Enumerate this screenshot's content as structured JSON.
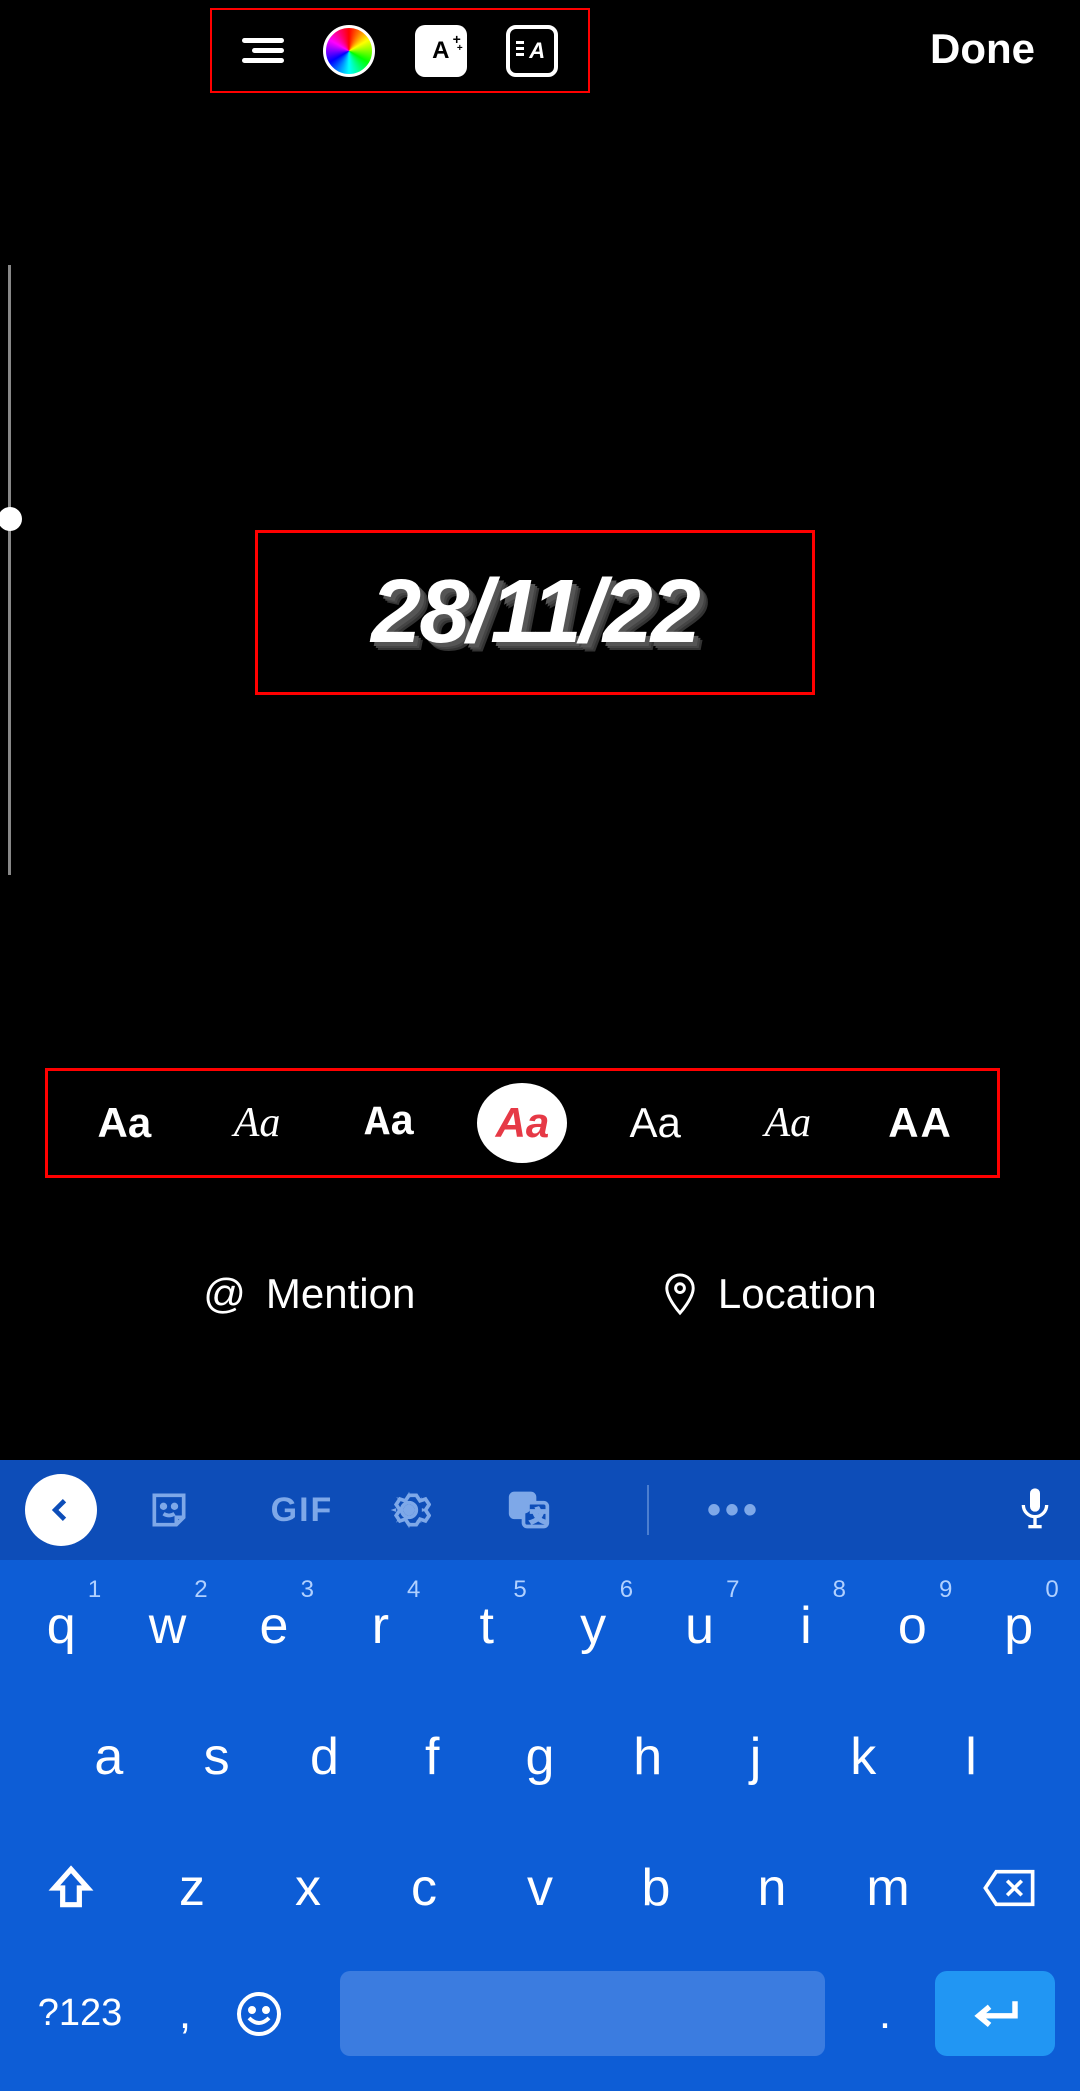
{
  "toolbar": {
    "done_label": "Done",
    "effects_letter": "A",
    "animate_letter": "A"
  },
  "canvas": {
    "text_value": "28/11/22"
  },
  "fonts": {
    "options": [
      "Aa",
      "Aa",
      "Aa",
      "Aa",
      "Aa",
      "Aa",
      "AA"
    ],
    "selected_index": 3
  },
  "tags": {
    "mention_label": "Mention",
    "mention_symbol": "@",
    "location_label": "Location"
  },
  "keyboard": {
    "gif_label": "GIF",
    "dots": "•••",
    "symkey_label": "?123",
    "comma": ",",
    "period": ".",
    "row1": [
      {
        "k": "q",
        "n": "1"
      },
      {
        "k": "w",
        "n": "2"
      },
      {
        "k": "e",
        "n": "3"
      },
      {
        "k": "r",
        "n": "4"
      },
      {
        "k": "t",
        "n": "5"
      },
      {
        "k": "y",
        "n": "6"
      },
      {
        "k": "u",
        "n": "7"
      },
      {
        "k": "i",
        "n": "8"
      },
      {
        "k": "o",
        "n": "9"
      },
      {
        "k": "p",
        "n": "0"
      }
    ],
    "row2": [
      "a",
      "s",
      "d",
      "f",
      "g",
      "h",
      "j",
      "k",
      "l"
    ],
    "row3": [
      "z",
      "x",
      "c",
      "v",
      "b",
      "n",
      "m"
    ]
  }
}
